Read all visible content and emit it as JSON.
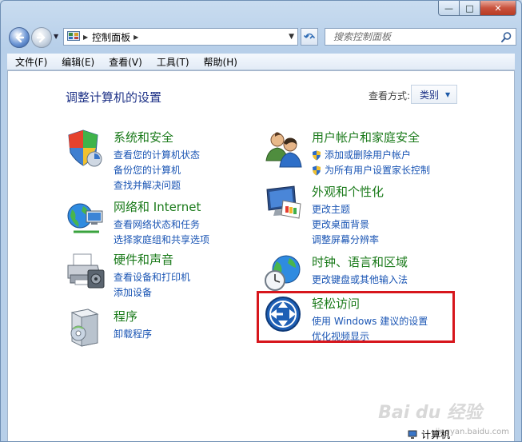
{
  "window": {
    "controls": {
      "minimize": "—",
      "maximize": "□",
      "close": "✕"
    }
  },
  "navbar": {
    "breadcrumb": "控制面板",
    "search_placeholder": "搜索控制面板"
  },
  "menubar": {
    "items": [
      "文件(F)",
      "编辑(E)",
      "查看(V)",
      "工具(T)",
      "帮助(H)"
    ]
  },
  "content": {
    "title": "调整计算机的设置",
    "view_by_label": "查看方式:",
    "view_by_value": "类别",
    "categories": [
      {
        "title": "系统和安全",
        "icon": "shield-icon",
        "links": [
          "查看您的计算机状态",
          "备份您的计算机",
          "查找并解决问题"
        ]
      },
      {
        "title": "网络和 Internet",
        "icon": "network-icon",
        "links": [
          "查看网络状态和任务",
          "选择家庭组和共享选项"
        ]
      },
      {
        "title": "硬件和声音",
        "icon": "printer-icon",
        "links": [
          "查看设备和打印机",
          "添加设备"
        ]
      },
      {
        "title": "程序",
        "icon": "programs-icon",
        "links": [
          "卸载程序"
        ]
      },
      {
        "title": "用户帐户和家庭安全",
        "icon": "users-icon",
        "links": [
          "添加或删除用户帐户",
          "为所有用户设置家长控制"
        ]
      },
      {
        "title": "外观和个性化",
        "icon": "appearance-icon",
        "links": [
          "更改主题",
          "更改桌面背景",
          "调整屏幕分辨率"
        ]
      },
      {
        "title": "时钟、语言和区域",
        "icon": "clock-globe-icon",
        "links": [
          "更改键盘或其他输入法"
        ]
      },
      {
        "title": "轻松访问",
        "icon": "ease-of-access-icon",
        "links": [
          "使用 Windows 建议的设置",
          "优化视频显示"
        ]
      }
    ]
  },
  "watermark": {
    "text": "Bai du 经验",
    "sub": "jingyan.baidu.com"
  },
  "statusbar": {
    "label": "计算机"
  },
  "colors": {
    "title": "#1e3287",
    "category": "#1a7a1a",
    "link": "#1a55b4",
    "highlight": "#d7161c"
  }
}
